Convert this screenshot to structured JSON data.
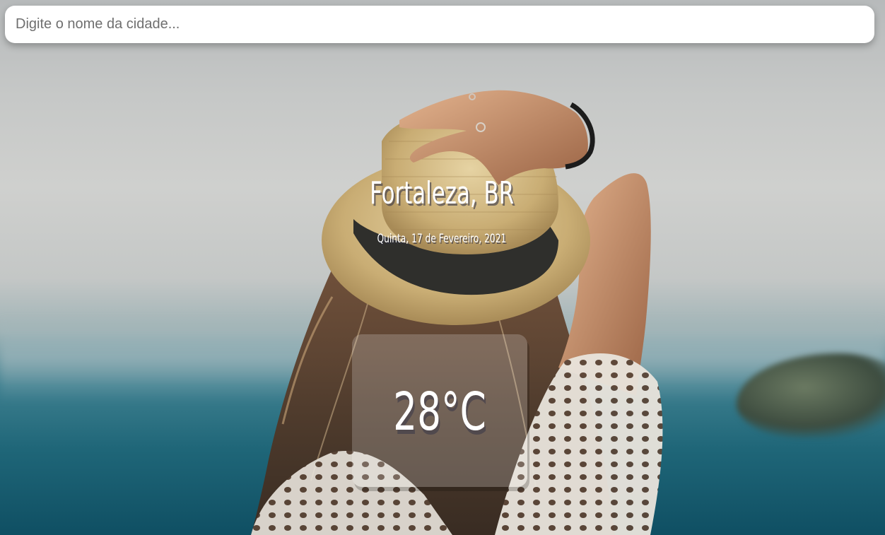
{
  "search": {
    "placeholder": "Digite o nome da cidade...",
    "value": ""
  },
  "location": {
    "city": "Fortaleza, BR",
    "date": "Quinta, 17 de Fevereiro, 2021"
  },
  "weather": {
    "temperature": "28°C"
  },
  "colors": {
    "text": "#ffffff",
    "search_bg": "#ffffff",
    "card_bg": "rgba(255,255,255,0.2)"
  }
}
